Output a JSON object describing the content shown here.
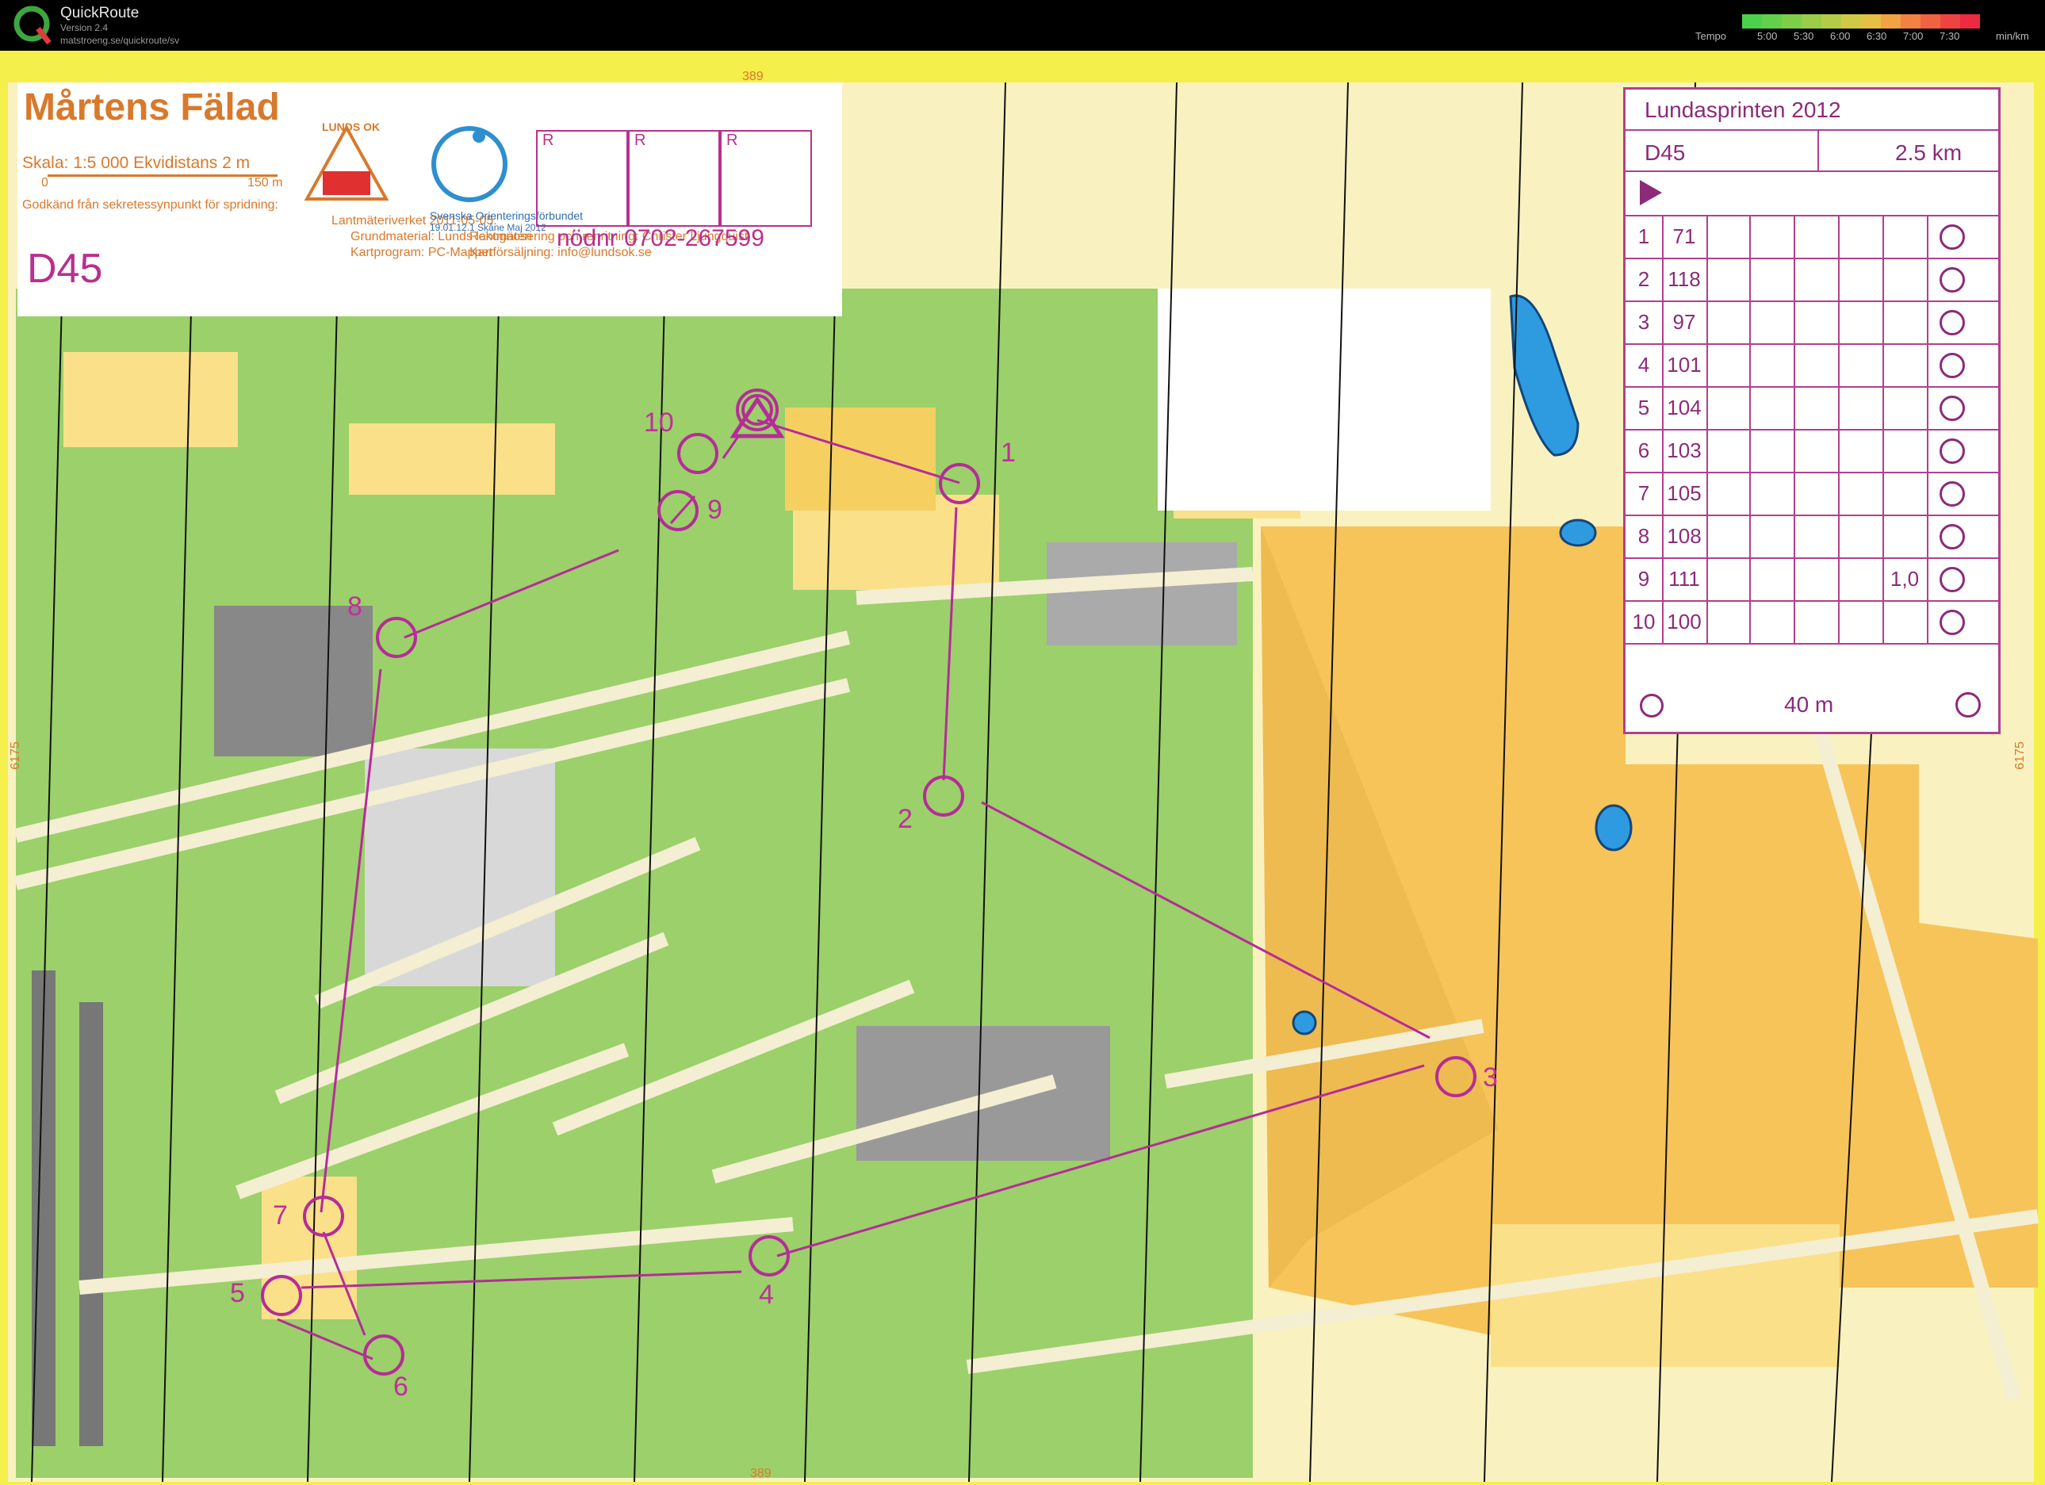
{
  "app": {
    "name": "QuickRoute",
    "version": "Version 2.4",
    "url": "matstroeng.se/quickroute/sv",
    "tempo_label": "Tempo",
    "tempo_ticks": [
      "5:00",
      "5:30",
      "6:00",
      "6:30",
      "7:00",
      "7:30"
    ],
    "tempo_unit": "min/km",
    "tempo_colors": [
      "#4bd14b",
      "#62d04a",
      "#7dcf49",
      "#9acd48",
      "#b4cb47",
      "#cfc946",
      "#e6bf45",
      "#f0a244",
      "#f28243",
      "#f06242",
      "#ee4441",
      "#ec2a40"
    ]
  },
  "map": {
    "title": "Mårtens Fälad",
    "scale": "Skala: 1:5 000   Ekvidistans 2 m",
    "scalebar_0": "0",
    "scalebar_150": "150 m",
    "approval": "Godkänd från sekretessynpunkt för spridning:",
    "authority": "Lantmäteriverket 2011-05-05:",
    "base": "Grundmaterial: Lunds lantmäteri",
    "software": "Kartprogram: PC-Mapper",
    "survey": "Rekognosering och renritning: Christer Ljungquist",
    "sales": "Kartförsäljning: info@lundsok.se",
    "club_logo": "LUNDS OK",
    "federation": "Svenska Orienteringsförbundet",
    "federation_sub": "19.01.12.1   Skåne Maj 2012",
    "class": "D45",
    "phone": "nödnr 0702-267599",
    "r_boxes": [
      "R",
      "R",
      "R"
    ],
    "grid_top": "389",
    "grid_bottom": "389",
    "grid_left": "6175",
    "grid_right": "6175"
  },
  "description": {
    "event": "Lundasprinten 2012",
    "class": "D45",
    "length": "2.5 km",
    "controls": [
      {
        "n": "1",
        "code": "71"
      },
      {
        "n": "2",
        "code": "118"
      },
      {
        "n": "3",
        "code": "97"
      },
      {
        "n": "4",
        "code": "101"
      },
      {
        "n": "5",
        "code": "104"
      },
      {
        "n": "6",
        "code": "103"
      },
      {
        "n": "7",
        "code": "105"
      },
      {
        "n": "8",
        "code": "108"
      },
      {
        "n": "9",
        "code": "111",
        "extra": "1,0"
      },
      {
        "n": "10",
        "code": "100"
      }
    ],
    "finish": "40 m"
  },
  "controls_on_map": [
    "1",
    "2",
    "3",
    "4",
    "5",
    "6",
    "7",
    "8",
    "9",
    "10"
  ]
}
